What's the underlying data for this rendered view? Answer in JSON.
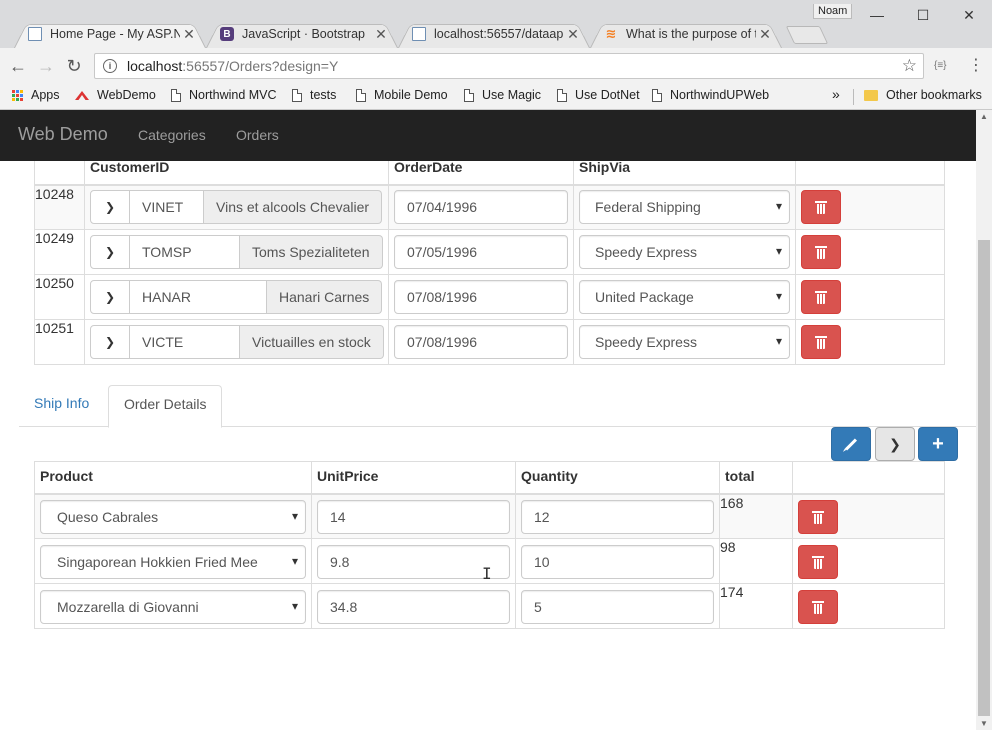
{
  "browser": {
    "profile_name": "Noam",
    "tabs": [
      {
        "title": "Home Page - My ASP.NE",
        "close": "✕"
      },
      {
        "title": "JavaScript · Bootstrap",
        "close": "✕"
      },
      {
        "title": "localhost:56557/dataapi",
        "close": "✕"
      },
      {
        "title": "What is the purpose of th",
        "close": "✕"
      }
    ],
    "url_host": "localhost",
    "url_rest": ":56557/Orders?design=Y",
    "bookmarks": {
      "apps": "Apps",
      "items": [
        "WebDemo",
        "Northwind MVC",
        "tests",
        "Mobile Demo",
        "Use Magic",
        "Use DotNet",
        "NorthwindUPWeb"
      ],
      "overflow": "»",
      "other": "Other bookmarks"
    }
  },
  "navbar": {
    "brand": "Web Demo",
    "links": [
      "Categories",
      "Orders"
    ]
  },
  "orders": {
    "columns": [
      "CustomerID",
      "OrderDate",
      "ShipVia"
    ],
    "rows": [
      {
        "id": "10248",
        "customer_code": "VINET",
        "customer_name": "Vins et alcools Chevalier",
        "order_date": "07/04/1996",
        "ship_via": "Federal Shipping"
      },
      {
        "id": "10249",
        "customer_code": "TOMSP",
        "customer_name": "Toms Spezialiteten",
        "order_date": "07/05/1996",
        "ship_via": "Speedy Express"
      },
      {
        "id": "10250",
        "customer_code": "HANAR",
        "customer_name": "Hanari Carnes",
        "order_date": "07/08/1996",
        "ship_via": "United Package"
      },
      {
        "id": "10251",
        "customer_code": "VICTE",
        "customer_name": "Victuailles en stock",
        "order_date": "07/08/1996",
        "ship_via": "Speedy Express"
      }
    ]
  },
  "detail_tabs": [
    "Ship Info",
    "Order Details"
  ],
  "order_details": {
    "columns": [
      "Product",
      "UnitPrice",
      "Quantity",
      "total"
    ],
    "rows": [
      {
        "product": "Queso Cabrales",
        "unit_price": "14",
        "quantity": "12",
        "total": "168"
      },
      {
        "product": "Singaporean Hokkien Fried Mee",
        "unit_price": "9.8",
        "quantity": "10",
        "total": "98"
      },
      {
        "product": "Mozzarella di Giovanni",
        "unit_price": "34.8",
        "quantity": "5",
        "total": "174"
      }
    ]
  },
  "colors": {
    "navbar": "#222222",
    "primary": "#337ab7",
    "danger": "#d9534f",
    "link": "#337ab7"
  },
  "icons": [
    "back-arrow-icon",
    "forward-arrow-icon",
    "reload-icon",
    "info-icon",
    "star-icon",
    "menu-icon",
    "chevron-down-icon",
    "trash-icon",
    "pencil-icon",
    "chevron-right-icon",
    "plus-icon"
  ]
}
